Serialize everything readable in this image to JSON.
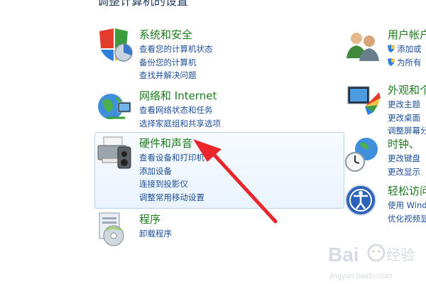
{
  "header": {
    "partial_title": "调整计算机的设置"
  },
  "left": [
    {
      "title": "系统和安全",
      "icon": "shield-icon",
      "links": [
        "查看您的计算机状态",
        "备份您的计算机",
        "查找并解决问题"
      ]
    },
    {
      "title": "网络和 Internet",
      "icon": "network-globe-icon",
      "links": [
        "查看网络状态和任务",
        "选择家庭组和共享选项"
      ]
    },
    {
      "title": "硬件和声音",
      "icon": "printer-speaker-icon",
      "links": [
        "查看设备和打印机",
        "添加设备",
        "连接到投影仪",
        "调整常用移动设置"
      ]
    },
    {
      "title": "程序",
      "icon": "programs-disc-icon",
      "links": [
        "卸载程序"
      ]
    }
  ],
  "right": [
    {
      "title": "用户帐户",
      "icon": "users-icon",
      "links": [
        "添加或",
        "为所有"
      ]
    },
    {
      "title": "外观和个",
      "icon": "appearance-icon",
      "links": [
        "更改主题",
        "更改桌面",
        "调整屏幕分"
      ]
    },
    {
      "title": "时钟、",
      "icon": "clock-globe-icon",
      "links": [
        "更改键盘",
        "更改显示"
      ]
    },
    {
      "title": "轻松访问",
      "icon": "ease-of-access-icon",
      "links": [
        "使用 Windo",
        "优化视频显"
      ]
    }
  ],
  "watermark": {
    "brand": "Bai",
    "brand2": "经验",
    "url": "jingyan.baidu.com"
  },
  "colors": {
    "title_green": "#1e7b1e",
    "link_blue": "#1e4f99",
    "arrow_red": "#e8262b",
    "hover_border": "#b7d3ee"
  }
}
